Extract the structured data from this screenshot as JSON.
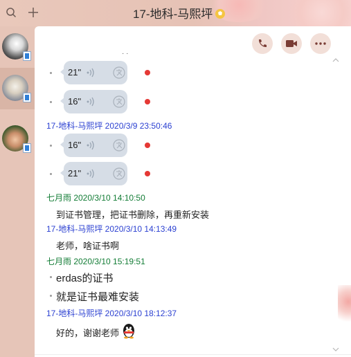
{
  "window": {
    "title": "17-地科-马熙坪"
  },
  "topbar": {
    "icons": [
      "search-icon",
      "plus-icon"
    ]
  },
  "sidebar": {
    "contacts": [
      {
        "name": "contact-1",
        "active": false
      },
      {
        "name": "contact-2",
        "active": true
      },
      {
        "name": "contact-3",
        "active": false
      }
    ]
  },
  "actions": {
    "icons": [
      "phone-icon",
      "video-icon",
      "more-icon"
    ]
  },
  "chat": {
    "partial_top": "· ·",
    "voice_group_1": [
      {
        "duration": "21\""
      },
      {
        "duration": "16\""
      }
    ],
    "sender_1": "17-地科-马熙坪 2020/3/9 23:50:46",
    "voice_group_2": [
      {
        "duration": "16\""
      },
      {
        "duration": "21\""
      }
    ],
    "sender_2": "七月雨 2020/3/10 14:10:50",
    "msg_2": "到证书管理，把证书删除，再重新安装",
    "sender_3": "17-地科-马熙坪 2020/3/10 14:13:49",
    "msg_3": "老师，啥证书啊",
    "sender_4": "七月雨 2020/3/10 15:19:51",
    "msg_4a": "erdas的证书",
    "msg_4b": "就是证书最难安装",
    "sender_5": "17-地科-马熙坪 2020/3/10 18:12:37",
    "msg_5": "好的，谢谢老师"
  },
  "colors": {
    "accent_blue_sender": "#2a3fd1",
    "accent_green_sender": "#127c35",
    "unread_dot": "#e53935",
    "voice_bubble": "#d6dde6"
  }
}
